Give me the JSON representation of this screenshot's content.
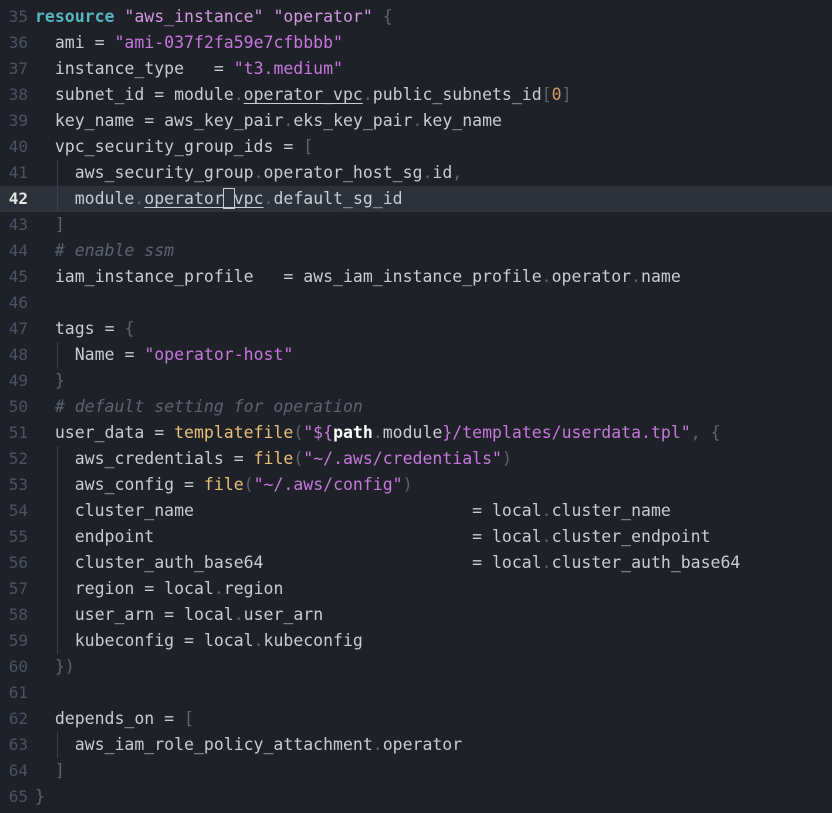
{
  "editor": {
    "current_line": "42",
    "lines": [
      {
        "n": "35"
      },
      {
        "n": "36"
      },
      {
        "n": "37"
      },
      {
        "n": "38"
      },
      {
        "n": "39"
      },
      {
        "n": "40"
      },
      {
        "n": "41"
      },
      {
        "n": "42"
      },
      {
        "n": "43"
      },
      {
        "n": "44"
      },
      {
        "n": "45"
      },
      {
        "n": "46"
      },
      {
        "n": "47"
      },
      {
        "n": "48"
      },
      {
        "n": "49"
      },
      {
        "n": "50"
      },
      {
        "n": "51"
      },
      {
        "n": "52"
      },
      {
        "n": "53"
      },
      {
        "n": "54"
      },
      {
        "n": "55"
      },
      {
        "n": "56"
      },
      {
        "n": "57"
      },
      {
        "n": "58"
      },
      {
        "n": "59"
      },
      {
        "n": "60"
      },
      {
        "n": "61"
      },
      {
        "n": "62"
      },
      {
        "n": "63"
      },
      {
        "n": "64"
      },
      {
        "n": "65"
      }
    ],
    "tok": {
      "resource": "resource",
      "aws_instance": "\"aws_instance\"",
      "operator_q": "\"operator\"",
      "lbrace": "{",
      "rbrace": "}",
      "ami": "ami",
      "eq": "=",
      "ami_val": "\"ami-037f2fa59e7cfbbbb\"",
      "instance_type": "instance_type",
      "t3": "\"t3.medium\"",
      "subnet_id": "subnet_id",
      "module": "module",
      "operator_vpc": "operator_vpc",
      "public_subnets_id": "public_subnets_id",
      "lbr": "[",
      "rbr": "]",
      "zero": "0",
      "key_name": "key_name",
      "aws_key_pair": "aws_key_pair",
      "eks_key_pair": "eks_key_pair",
      "vpc_security_group_ids": "vpc_security_group_ids",
      "aws_security_group": "aws_security_group",
      "operator_host_sg": "operator_host_sg",
      "id": "id",
      "comma": ",",
      "operator_pre": "operator",
      "operator_cursor": "_",
      "operator_post": "vpc",
      "default_sg_id": "default_sg_id",
      "cmt_ssm": "# enable ssm",
      "iam_instance_profile": "iam_instance_profile",
      "aws_iam_instance_profile": "aws_iam_instance_profile",
      "operator": "operator",
      "name": "name",
      "tags": "tags",
      "Name": "Name",
      "operator_host": "\"operator-host\"",
      "cmt_default": "# default setting for operation",
      "user_data": "user_data",
      "templatefile": "templatefile",
      "lparen": "(",
      "rparen": ")",
      "interp_open": "\"${",
      "path": "path",
      "interp_close": "}/templates/userdata.tpl\"",
      "aws_credentials": "aws_credentials",
      "file": "file",
      "cred_path": "\"~/.aws/credentials\"",
      "aws_config": "aws_config",
      "config_path": "\"~/.aws/config\"",
      "cluster_name": "cluster_name",
      "local": "local",
      "endpoint": "endpoint",
      "cluster_endpoint": "cluster_endpoint",
      "cluster_auth_base64": "cluster_auth_base64",
      "region": "region",
      "user_arn": "user_arn",
      "kubeconfig": "kubeconfig",
      "close_brace_paren": "})",
      "depends_on": "depends_on",
      "aws_iam_role_policy_attachment": "aws_iam_role_policy_attachment"
    }
  }
}
